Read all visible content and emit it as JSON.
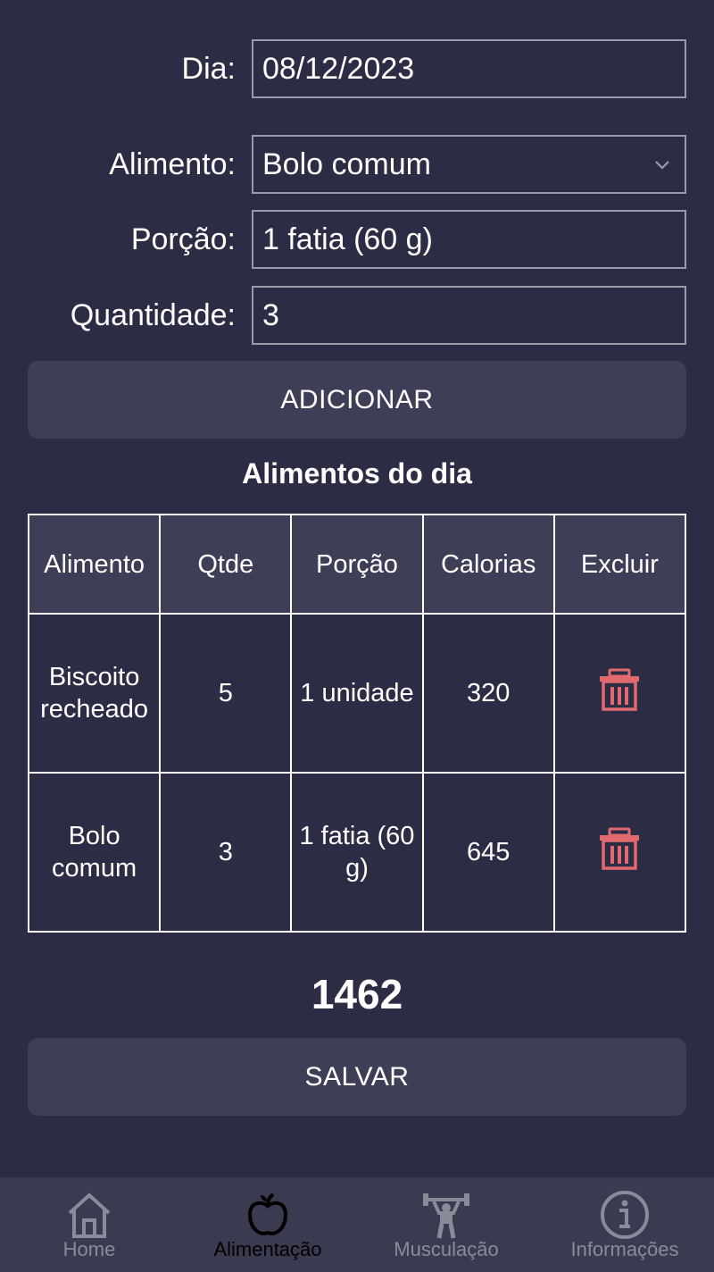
{
  "form": {
    "dia": {
      "label": "Dia:",
      "value": "08/12/2023"
    },
    "alimento": {
      "label": "Alimento:",
      "value": "Bolo comum"
    },
    "porcao": {
      "label": "Porção:",
      "value": "1 fatia (60 g)"
    },
    "quantidade": {
      "label": "Quantidade:",
      "value": "3"
    }
  },
  "buttons": {
    "add": "ADICIONAR",
    "save": "SALVAR"
  },
  "table": {
    "title": "Alimentos do dia",
    "headers": [
      "Alimento",
      "Qtde",
      "Porção",
      "Calorias",
      "Excluir"
    ],
    "rows": [
      {
        "alimento": "Biscoito recheado",
        "qtde": "5",
        "porcao": "1 unidade",
        "calorias": "320"
      },
      {
        "alimento": "Bolo comum",
        "qtde": "3",
        "porcao": "1 fatia (60 g)",
        "calorias": "645"
      }
    ]
  },
  "total": "1462",
  "colors": {
    "background": "#2c2d44",
    "button": "#3e3f56",
    "trash": "#e06a6e",
    "nav_inactive": "#8a8b99"
  },
  "nav": [
    {
      "label": "Home",
      "icon": "home-icon"
    },
    {
      "label": "Alimentação",
      "icon": "apple-icon",
      "active": true
    },
    {
      "label": "Musculação",
      "icon": "weightlifter-icon"
    },
    {
      "label": "Informações",
      "icon": "info-icon"
    }
  ]
}
